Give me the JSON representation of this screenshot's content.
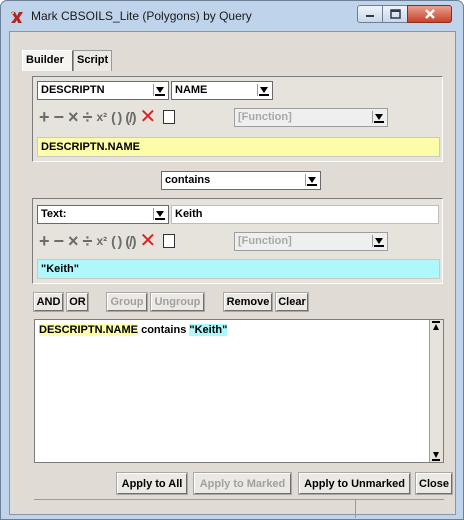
{
  "window": {
    "title": "Mark CBSOILS_Lite (Polygons) by Query",
    "close_color": "#c7422b"
  },
  "tabs": [
    {
      "label": "Builder",
      "active": true
    },
    {
      "label": "Script",
      "active": false
    }
  ],
  "left_expr": {
    "field_dropdown": "DESCRIPTN",
    "name_dropdown": "NAME",
    "function_dropdown": "[Function]",
    "expression": "DESCRIPTN.NAME",
    "expression_color": "#fcfca9"
  },
  "operator": {
    "selected": "contains"
  },
  "right_expr": {
    "type_dropdown": "Text:",
    "value_input": "Keith",
    "function_dropdown": "[Function]",
    "expression": "\"Keith\"",
    "expression_color": "#aef8fb"
  },
  "operator_icons": [
    "plus-icon",
    "minus-icon",
    "multiply-icon",
    "divide-icon",
    "power-icon",
    "parentheses-icon",
    "no-parentheses-icon",
    "delete-icon",
    "document-icon"
  ],
  "operators_text": {
    "plus": "+",
    "minus": "−",
    "times": "×",
    "divide": "÷",
    "power": "x²",
    "parens": "( )",
    "noparens": "(/)",
    "del": "✕"
  },
  "builder_buttons": {
    "and": "AND",
    "or": "OR",
    "group": "Group",
    "ungroup": "Ungroup",
    "remove": "Remove",
    "clear": "Clear"
  },
  "query": {
    "left": "DESCRIPTN.NAME",
    "operator": "contains",
    "right": "\"Keith\""
  },
  "actions": {
    "apply_all": "Apply to All",
    "apply_marked": "Apply to Marked",
    "apply_unmarked": "Apply to Unmarked",
    "close": "Close"
  }
}
